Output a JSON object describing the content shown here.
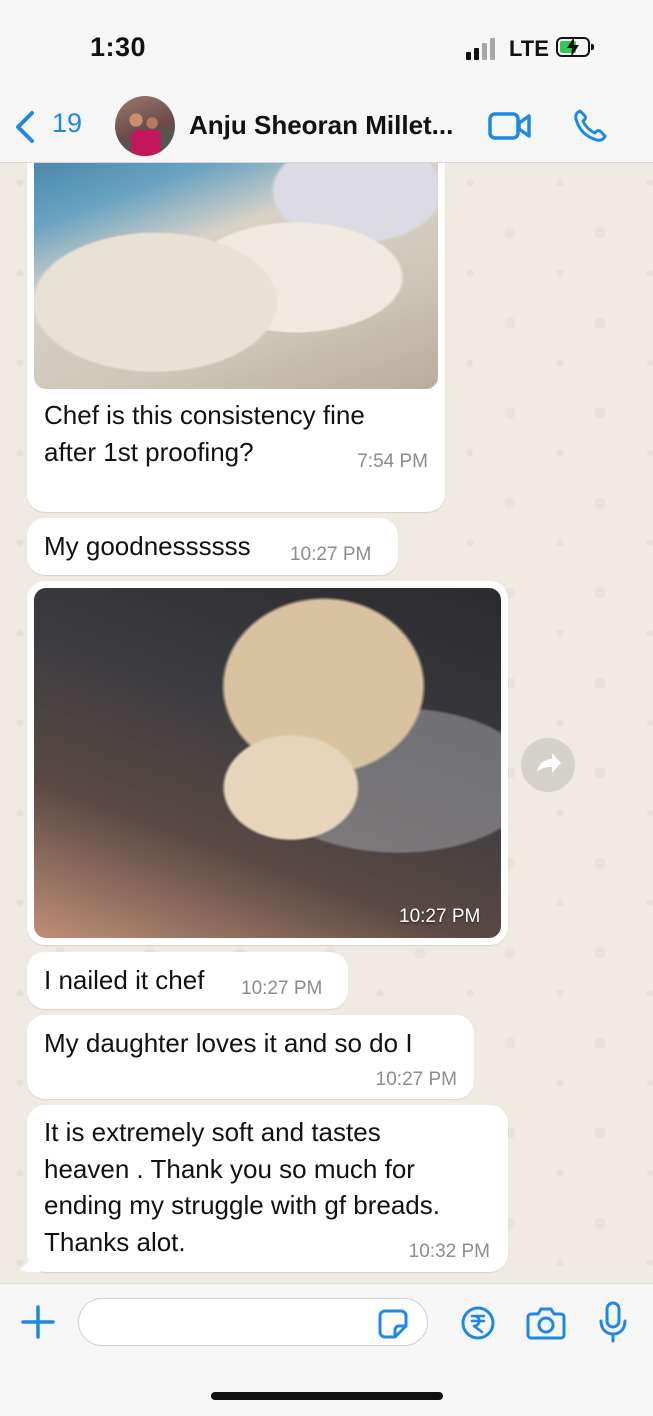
{
  "status": {
    "time": "1:30",
    "network": "LTE",
    "battery_color": "#34c759"
  },
  "header": {
    "back_count": "19",
    "contact_name": "Anju Sheoran Millet...",
    "accent": "#1e88e5"
  },
  "messages": [
    {
      "type": "image-text",
      "text_lines": [
        "Chef is this consistency fine",
        "after 1st proofing?"
      ],
      "time": "7:54 PM",
      "image": "dough-photo"
    },
    {
      "type": "text",
      "text_lines": [
        "My goodnessssss"
      ],
      "time": "10:27 PM"
    },
    {
      "type": "image",
      "time": "10:27 PM",
      "image": "bread-photo"
    },
    {
      "type": "text",
      "text_lines": [
        "I nailed it chef"
      ],
      "time": "10:27 PM"
    },
    {
      "type": "text",
      "text_lines": [
        "My daughter loves it and so do I"
      ],
      "time": "10:27 PM"
    },
    {
      "type": "text",
      "text_lines": [
        "It is extremely soft and tastes",
        "heaven . Thank you so much for",
        "ending my struggle with gf breads.",
        "Thanks alot."
      ],
      "time": "10:32 PM"
    }
  ],
  "input": {
    "placeholder": ""
  },
  "icons": [
    "back-chevron-icon",
    "video-call-icon",
    "phone-icon",
    "forward-icon",
    "plus-icon",
    "sticker-icon",
    "rupee-icon",
    "camera-icon",
    "mic-icon"
  ]
}
